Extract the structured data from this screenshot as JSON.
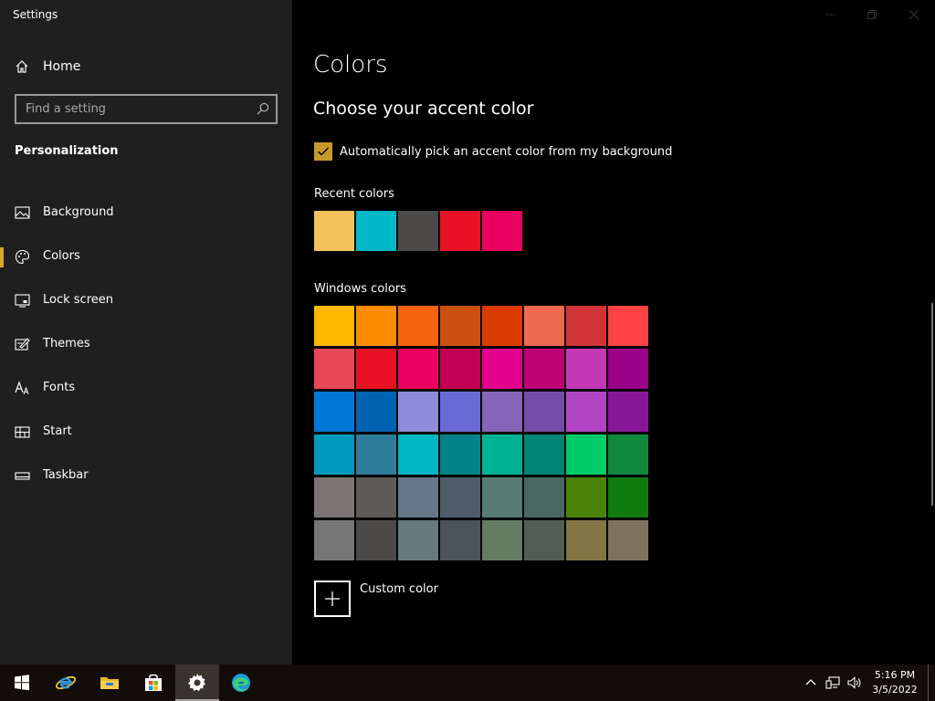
{
  "window": {
    "title": "Settings"
  },
  "sidebar": {
    "home_label": "Home",
    "search_placeholder": "Find a setting",
    "section_title": "Personalization",
    "items": [
      {
        "label": "Background",
        "icon": "image-icon",
        "selected": false
      },
      {
        "label": "Colors",
        "icon": "palette-icon",
        "selected": true
      },
      {
        "label": "Lock screen",
        "icon": "lock-screen-icon",
        "selected": false
      },
      {
        "label": "Themes",
        "icon": "brush-icon",
        "selected": false
      },
      {
        "label": "Fonts",
        "icon": "font-icon",
        "selected": false
      },
      {
        "label": "Start",
        "icon": "start-icon",
        "selected": false
      },
      {
        "label": "Taskbar",
        "icon": "taskbar-icon",
        "selected": false
      }
    ],
    "accent_color": "#d9a627"
  },
  "main": {
    "title": "Colors",
    "subtitle": "Choose your accent color",
    "auto_pick": {
      "label": "Automatically pick an accent color from my background",
      "checked": true,
      "color": "#c79a2a"
    },
    "recent_label": "Recent colors",
    "recent_colors": [
      "#f2c35a",
      "#00b8c8",
      "#4c4a48",
      "#e81224",
      "#ea005e"
    ],
    "windows_label": "Windows colors",
    "windows_colors": [
      "#ffb900",
      "#ff8c00",
      "#f7630c",
      "#ca5010",
      "#da3b01",
      "#ef6950",
      "#d13438",
      "#ff4343",
      "#e74856",
      "#e81123",
      "#ea005e",
      "#c30052",
      "#e3008c",
      "#bf0077",
      "#c239b3",
      "#9a0089",
      "#0078d7",
      "#0063b1",
      "#8e8cd8",
      "#6b69d6",
      "#8764b8",
      "#744da9",
      "#b146c2",
      "#881798",
      "#0099bc",
      "#2d7d9a",
      "#00b7c3",
      "#038387",
      "#00b294",
      "#018574",
      "#00cc6a",
      "#10893e",
      "#7a7574",
      "#5d5a58",
      "#68768a",
      "#515c6b",
      "#567c73",
      "#486860",
      "#498205",
      "#107c10",
      "#767676",
      "#4c4a48",
      "#69797e",
      "#4a5459",
      "#647c64",
      "#525e54",
      "#847545",
      "#7e735f"
    ],
    "custom_color_label": "Custom color"
  },
  "taskbar": {
    "apps": [
      {
        "name": "start-button",
        "icon": "windows-logo-icon"
      },
      {
        "name": "internet-explorer-button",
        "icon": "internet-explorer-icon"
      },
      {
        "name": "file-explorer-button",
        "icon": "folder-icon"
      },
      {
        "name": "store-button",
        "icon": "store-icon"
      },
      {
        "name": "settings-button",
        "icon": "gear-icon",
        "active": true
      },
      {
        "name": "edge-button",
        "icon": "edge-icon"
      }
    ],
    "clock": {
      "time": "5:16 PM",
      "date": "3/5/2022"
    }
  }
}
